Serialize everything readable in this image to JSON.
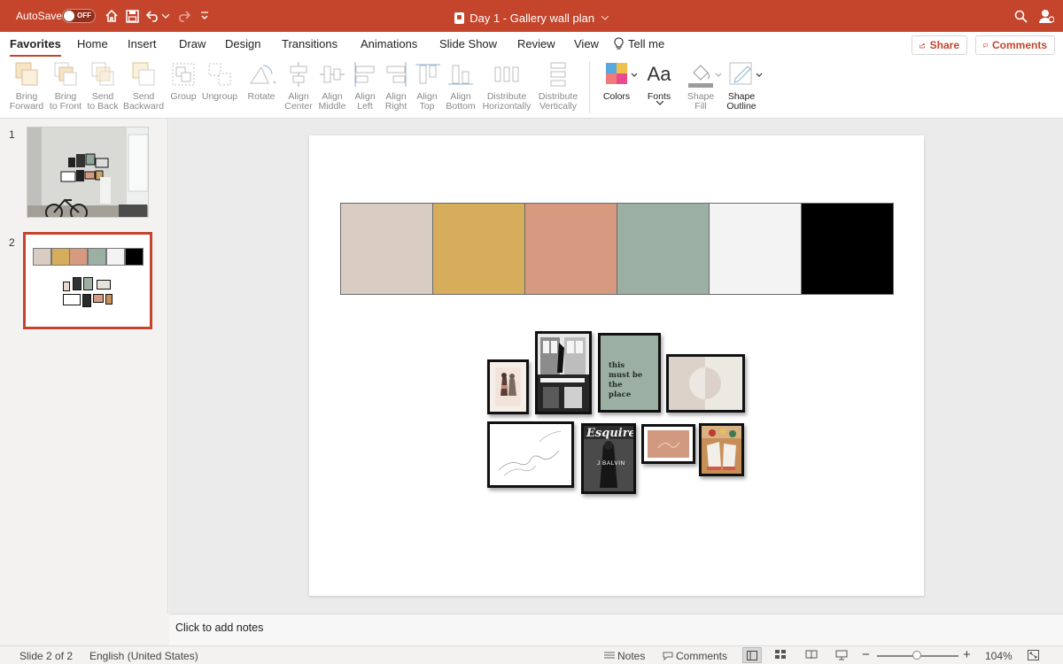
{
  "titlebar": {
    "autosave_label": "AutoSave",
    "toggle_state": "OFF",
    "doc_title": "Day 1 - Gallery wall plan"
  },
  "tabs": [
    "Favorites",
    "Home",
    "Insert",
    "Draw",
    "Design",
    "Transitions",
    "Animations",
    "Slide Show",
    "Review",
    "View",
    "Tell me"
  ],
  "share_label": "Share",
  "comments_label": "Comments",
  "ribbon": {
    "bring_forward": [
      "Bring",
      "Forward"
    ],
    "bring_to_front": [
      "Bring",
      "to Front"
    ],
    "send_to_back": [
      "Send",
      "to Back"
    ],
    "send_backward": [
      "Send",
      "Backward"
    ],
    "group": "Group",
    "ungroup": "Ungroup",
    "rotate": "Rotate",
    "align_center": [
      "Align",
      "Center"
    ],
    "align_middle": [
      "Align",
      "Middle"
    ],
    "align_left": [
      "Align",
      "Left"
    ],
    "align_right": [
      "Align",
      "Right"
    ],
    "align_top": [
      "Align",
      "Top"
    ],
    "align_bottom": [
      "Align",
      "Bottom"
    ],
    "distribute_h": [
      "Distribute",
      "Horizontally"
    ],
    "distribute_v": [
      "Distribute",
      "Vertically"
    ],
    "colors": "Colors",
    "fonts": "Fonts",
    "fonts_glyph": "Aa",
    "shape_fill": [
      "Shape",
      "Fill"
    ],
    "shape_outline": [
      "Shape",
      "Outline"
    ]
  },
  "slides": [
    {
      "number": "1"
    },
    {
      "number": "2"
    }
  ],
  "palette": [
    "#d8ccc3",
    "#d6ad5b",
    "#d59a80",
    "#9bb0a2",
    "#f3f3f3",
    "#000000"
  ],
  "art": {
    "quote": [
      "this",
      "must be",
      "the",
      "place"
    ],
    "magazine_name": "Esquire",
    "magazine_cover": "J BALVIN"
  },
  "notes_placeholder": "Click to add notes",
  "status": {
    "slide_count": "Slide 2 of 2",
    "language": "English (United States)",
    "notes": "Notes",
    "comments": "Comments",
    "zoom_minus": "−",
    "zoom_plus": "+",
    "zoom": "104%"
  }
}
